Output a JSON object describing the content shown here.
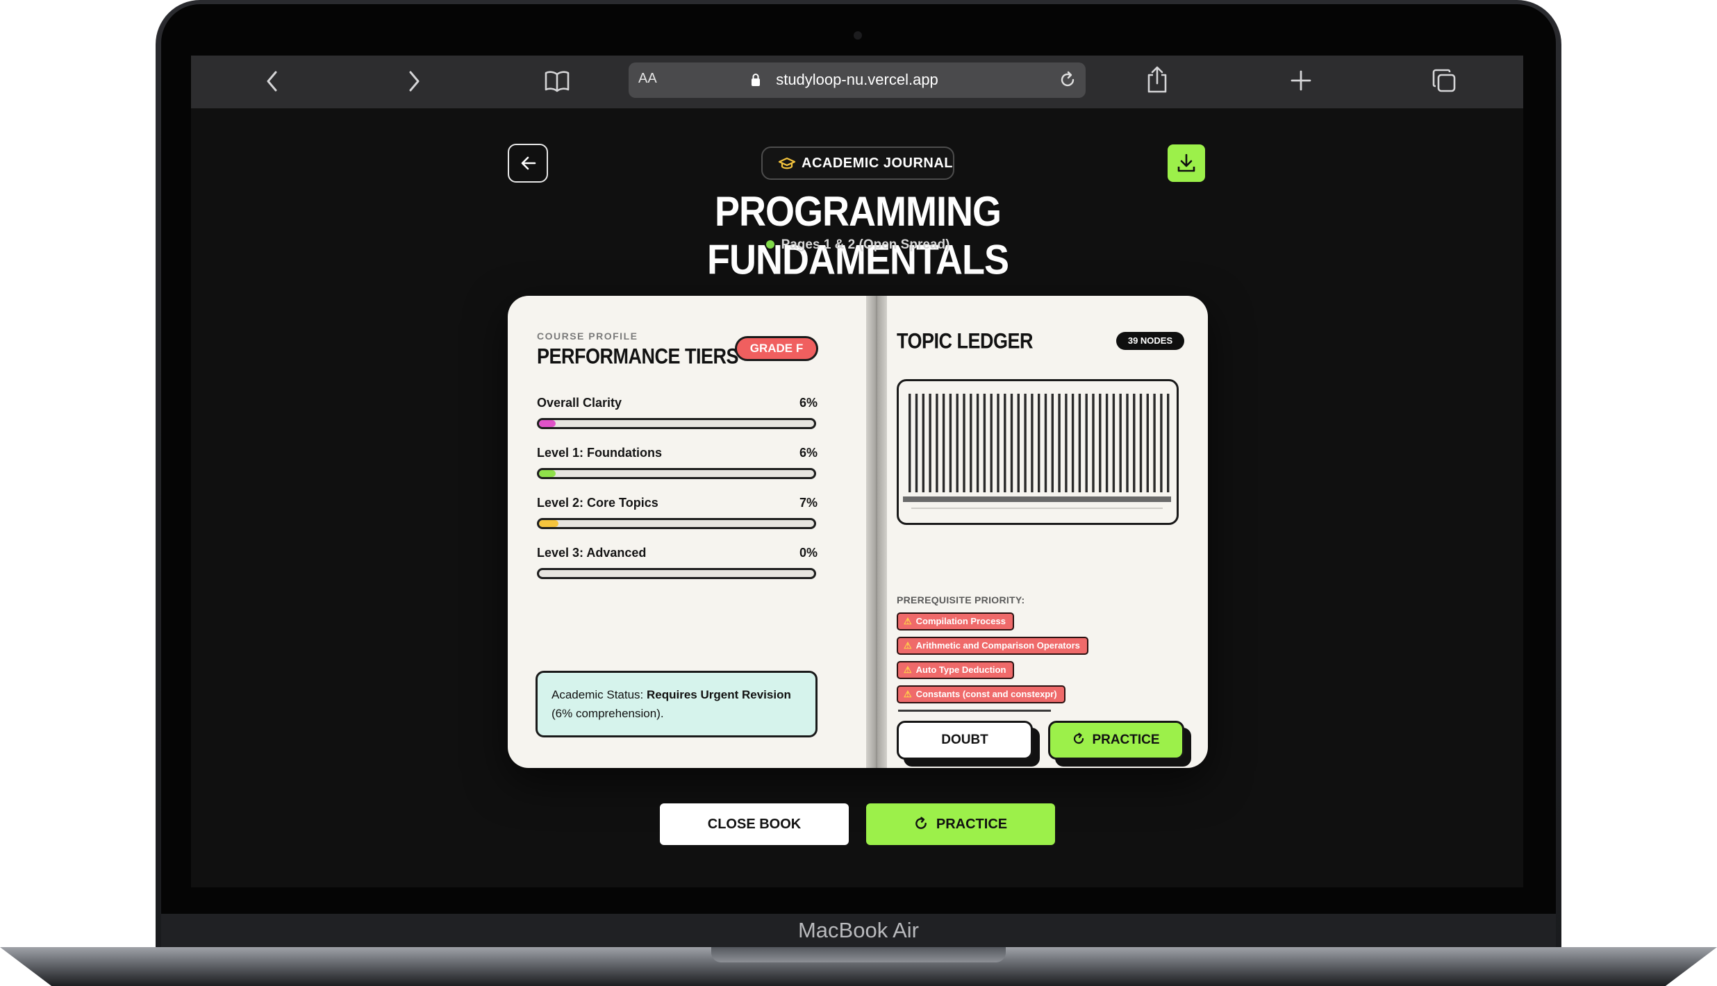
{
  "device": {
    "label": "MacBook Air"
  },
  "browser": {
    "text_size_button": "AA",
    "url": "studyloop-nu.vercel.app",
    "icons": [
      "back-icon",
      "forward-icon",
      "bookmarks-icon",
      "lock-icon",
      "reload-icon",
      "share-icon",
      "new-tab-icon",
      "tabs-icon"
    ]
  },
  "header": {
    "badge": "ACADEMIC JOURNAL",
    "title": "PROGRAMMING FUNDAMENTALS",
    "subtitle": "Pages 1 & 2 (Open Spread)"
  },
  "left_page": {
    "eyebrow": "COURSE PROFILE",
    "heading": "PERFORMANCE TIERS",
    "grade": "GRADE F",
    "tiers": [
      {
        "label": "Overall Clarity",
        "value_text": "6%",
        "percent": 6,
        "color": "#e052c8"
      },
      {
        "label": "Level 1: Foundations",
        "value_text": "6%",
        "percent": 6,
        "color": "#8fe04a"
      },
      {
        "label": "Level 2: Core Topics",
        "value_text": "7%",
        "percent": 7,
        "color": "#f5c43d"
      },
      {
        "label": "Level 3: Advanced",
        "value_text": "0%",
        "percent": 0,
        "color": "#8fe04a"
      }
    ],
    "status_prefix": "Academic Status: ",
    "status_strong": "Requires Urgent Revision",
    "status_suffix": " (6% comprehension)."
  },
  "right_page": {
    "heading": "TOPIC LEDGER",
    "nodes_badge": "39 NODES",
    "prereq_label": "PREREQUISITE PRIORITY:",
    "prereq_items": [
      "Compilation Process",
      "Arithmetic and Comparison Operators",
      "Auto Type Deduction",
      "Constants (const and constexpr)"
    ],
    "doubt_label": "DOUBT",
    "practice_label": "PRACTICE"
  },
  "footer_actions": {
    "close_label": "CLOSE BOOK",
    "practice_label": "PRACTICE"
  },
  "colors": {
    "accent_green": "#9cf04a",
    "danger_red": "#ef6a6a",
    "status_bg": "#d6f3ec"
  }
}
